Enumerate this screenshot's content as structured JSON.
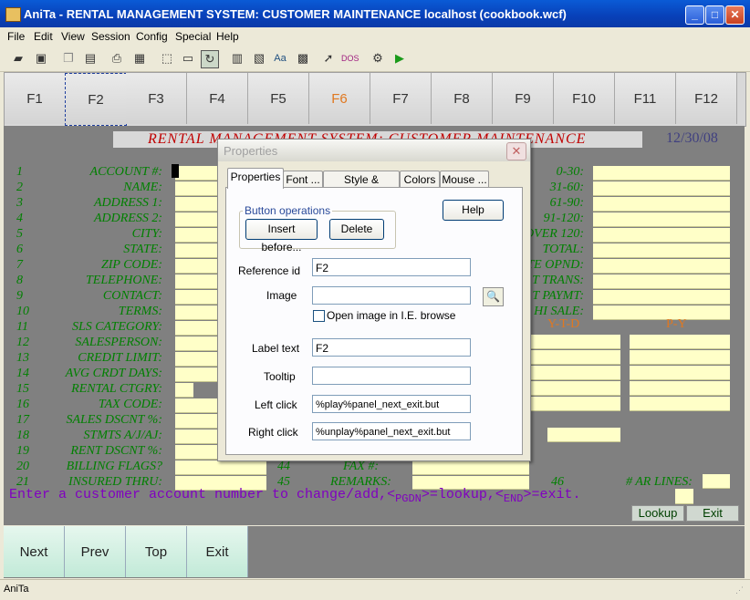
{
  "window": {
    "title": "AniTa - RENTAL MANAGEMENT SYSTEM: CUSTOMER MAINTENANCE  localhost (cookbook.wcf)",
    "minimize": "_",
    "maximize": "□",
    "close": "✕"
  },
  "menu": [
    "File",
    "Edit",
    "View",
    "Session",
    "Config",
    "Special",
    "Help"
  ],
  "toolbar_icons": [
    "open-folder-icon",
    "save-icon",
    "copy-icon",
    "paste-icon",
    "print-icon",
    "preview-icon",
    "select-icon",
    "label-icon",
    "refresh-icon",
    "grid-icon",
    "form-icon",
    "font-icon",
    "table-icon",
    "pointer-icon",
    "dos-icon",
    "settings-icon",
    "play-icon"
  ],
  "fkeys": [
    "F1",
    "F2",
    "F3",
    "F4",
    "F5",
    "F6",
    "F7",
    "F8",
    "F9",
    "F10",
    "F11",
    "F12"
  ],
  "screen": {
    "banner": "RENTAL MANAGEMENT SYSTEM: CUSTOMER MAINTENANCE",
    "date": "12/30/08",
    "rows": [
      {
        "num": "1",
        "label": "ACCOUNT #:"
      },
      {
        "num": "2",
        "label": "NAME:"
      },
      {
        "num": "3",
        "label": "ADDRESS 1:"
      },
      {
        "num": "4",
        "label": "ADDRESS 2:"
      },
      {
        "num": "5",
        "label": "CITY:"
      },
      {
        "num": "6",
        "label": "STATE:"
      },
      {
        "num": "7",
        "label": "ZIP CODE:"
      },
      {
        "num": "8",
        "label": "TELEPHONE:"
      },
      {
        "num": "9",
        "label": "CONTACT:"
      },
      {
        "num": "10",
        "label": "TERMS:"
      },
      {
        "num": "11",
        "label": "SLS CATEGORY:"
      },
      {
        "num": "12",
        "label": "SALESPERSON:"
      },
      {
        "num": "13",
        "label": "CREDIT LIMIT:"
      },
      {
        "num": "14",
        "label": "AVG CRDT DAYS:"
      },
      {
        "num": "15",
        "label": "RENTAL CTGRY:"
      },
      {
        "num": "16",
        "label": "TAX CODE:"
      },
      {
        "num": "17",
        "label": "SALES DSCNT %:"
      },
      {
        "num": "18",
        "label": "STMTS  A/J/AJ:"
      },
      {
        "num": "19",
        "label": "RENT DSCNT %:"
      },
      {
        "num": "20",
        "label": "BILLING FLAGS?"
      },
      {
        "num": "21",
        "label": "INSURED THRU:"
      }
    ],
    "right_labels": [
      "0-30:",
      "31-60:",
      "61-90:",
      "91-120:",
      "OVER 120:",
      "TOTAL:",
      "TE OPND:",
      "T TRANS:",
      "T PAYMT:",
      "HI SALE:"
    ],
    "col_headers": {
      "ytd": "Y-T-D",
      "py": "P-Y"
    },
    "row20_num": "44",
    "row20_label": "FAX #:",
    "row21_num": "45",
    "row21_label": "REMARKS:",
    "row21_num2": "46",
    "row21_label2": "# AR LINES:",
    "prompt_pre": "Enter a customer account number to change/add,<",
    "prompt_key1": "PGDN",
    "prompt_mid": ">=lookup,<",
    "prompt_key2": "END",
    "prompt_post": ">=exit.",
    "lookup": "Lookup",
    "exit": "Exit"
  },
  "bottom_buttons": [
    "Next",
    "Prev",
    "Top",
    "Exit"
  ],
  "status": "AniTa",
  "dialog": {
    "title": "Properties",
    "tabs": [
      "Properties",
      "Font ...",
      "Style & Position",
      "Colors",
      "Mouse ..."
    ],
    "group_title": "Button operations",
    "insert_before": "Insert before...",
    "delete": "Delete",
    "help": "Help",
    "reference_id_label": "Reference id",
    "reference_id": "F2",
    "image_label": "Image",
    "image_value": "",
    "open_image_label": "Open image in I.E. browse",
    "label_text_label": "Label text",
    "label_text": "F2",
    "tooltip_label": "Tooltip",
    "tooltip": "",
    "left_click_label": "Left click",
    "left_click": "%play%panel_next_exit.but",
    "right_click_label": "Right click",
    "right_click": "%unplay%panel_next_exit.but"
  }
}
